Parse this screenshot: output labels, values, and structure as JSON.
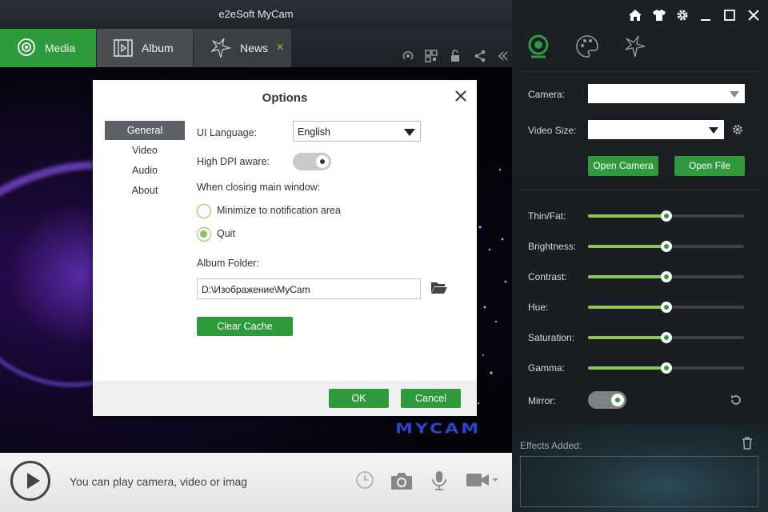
{
  "app": {
    "title": "e2eSoft MyCam"
  },
  "tabs": [
    {
      "label": "Media",
      "icon": "webcam-icon"
    },
    {
      "label": "Album",
      "icon": "film-icon"
    },
    {
      "label": "News",
      "icon": "star-icon",
      "close": "✕"
    }
  ],
  "preview": {
    "logo": "MYCAM"
  },
  "bottom": {
    "hint": "You can play camera, video or image"
  },
  "dialog": {
    "title": "Options",
    "nav": [
      "General",
      "Video",
      "Audio",
      "About"
    ],
    "ui_language_label": "UI Language:",
    "ui_language_value": "English",
    "high_dpi_label": "High DPI aware:",
    "high_dpi_on": true,
    "closing_label": "When closing main window:",
    "closing_options": [
      "Minimize to notification area",
      "Quit"
    ],
    "closing_selected": "Quit",
    "album_folder_label": "Album Folder:",
    "album_folder_value": "D:\\Изображение\\MyCam",
    "clear_cache": "Clear Cache",
    "ok": "OK",
    "cancel": "Cancel"
  },
  "panel": {
    "camera_label": "Camera:",
    "camera_value": "",
    "video_size_label": "Video Size:",
    "video_size_value": "",
    "open_camera": "Open Camera",
    "open_file": "Open File",
    "sliders": [
      {
        "label": "Thin/Fat:",
        "value": 0.5
      },
      {
        "label": "Brightness:",
        "value": 0.5
      },
      {
        "label": "Contrast:",
        "value": 0.5
      },
      {
        "label": "Hue:",
        "value": 0.5
      },
      {
        "label": "Saturation:",
        "value": 0.5
      },
      {
        "label": "Gamma:",
        "value": 0.5
      }
    ],
    "mirror_label": "Mirror:",
    "mirror_on": true,
    "effects_label": "Effects Added:"
  },
  "colors": {
    "accent": "#2f9a3c",
    "accent_light": "#8cc35a",
    "panel_bg": "#1c2024"
  }
}
